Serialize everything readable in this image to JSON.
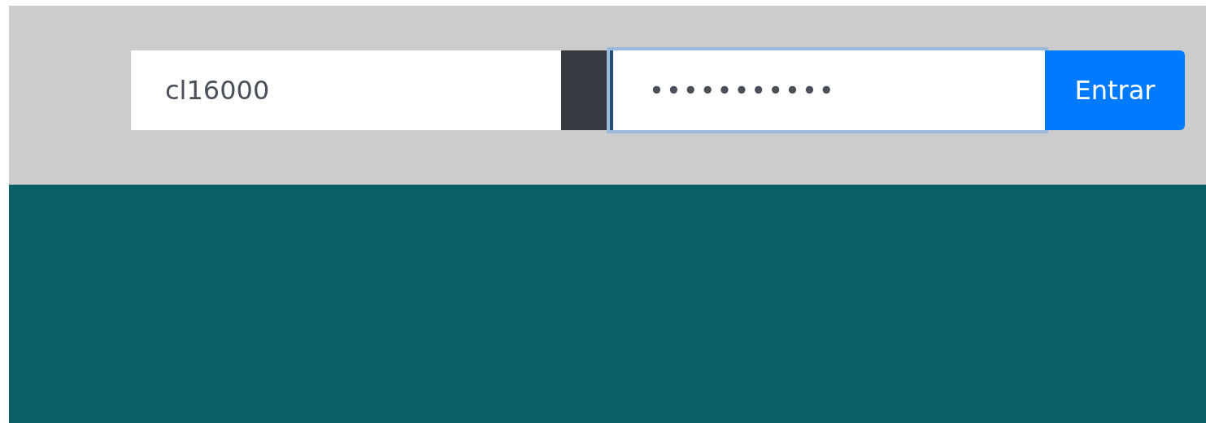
{
  "login_bar": {
    "username": {
      "value": "cl16000",
      "focused": false
    },
    "password": {
      "value": "•••••••••••",
      "focused": true
    },
    "button": {
      "label": "Entrar"
    }
  }
}
